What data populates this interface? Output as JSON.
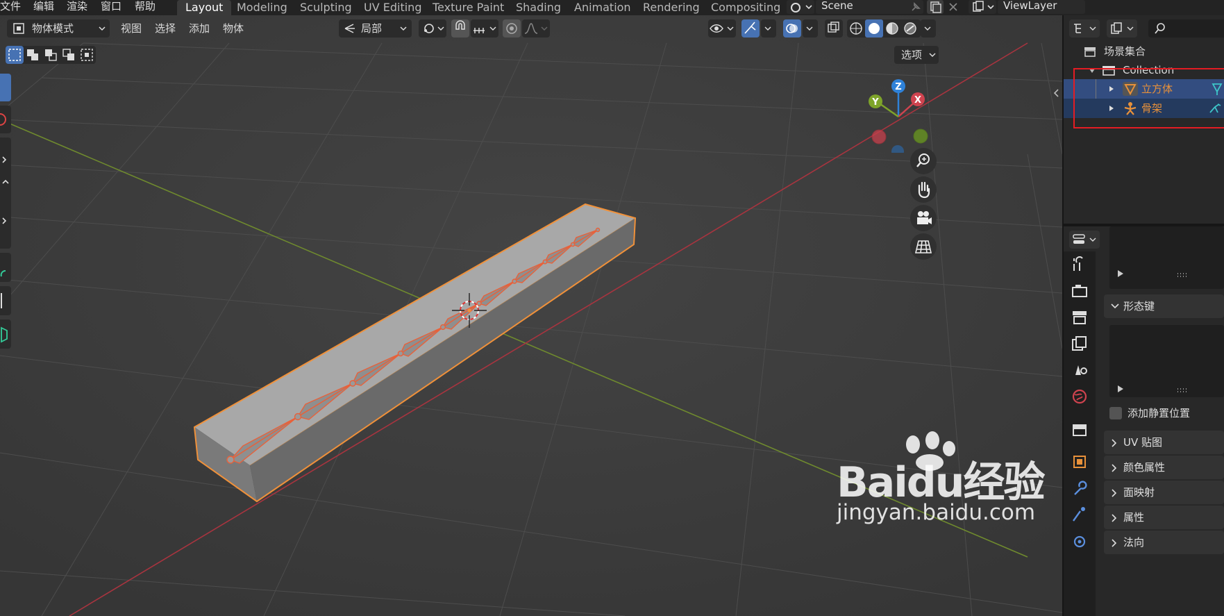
{
  "menu": [
    "文件",
    "编辑",
    "渲染",
    "窗口",
    "帮助"
  ],
  "workspaces": [
    "Layout",
    "Modeling",
    "Sculpting",
    "UV Editing",
    "Texture Paint",
    "Shading",
    "Animation",
    "Rendering",
    "Compositing"
  ],
  "active_workspace": "Layout",
  "scene_name": "Scene",
  "view_layer": "ViewLayer",
  "viewport_header": {
    "mode": "物体模式",
    "menus": [
      "视图",
      "选择",
      "添加",
      "物体"
    ],
    "transform_orientation": "局部",
    "options_label": "选项"
  },
  "gizmo": {
    "x": "X",
    "y": "Y",
    "z": "Z"
  },
  "outliner": {
    "root": "场景集合",
    "collection": "Collection",
    "items": [
      {
        "label": "立方体",
        "color": "#e8913a"
      },
      {
        "label": "骨架",
        "color": "#e8913a"
      }
    ]
  },
  "properties": {
    "shape_keys": "形态键",
    "add_rest_position": "添加静置位置",
    "uv_maps": "UV 贴图",
    "color_attributes": "颜色属性",
    "face_maps": "面映射",
    "attributes": "属性",
    "normals": "法向"
  },
  "watermark": {
    "brand": "Baidu经验",
    "url": "jingyan.baidu.com"
  },
  "colors": {
    "accent": "#4772b3",
    "selection": "#e8913a",
    "x_axis": "#d0434f",
    "y_axis": "#7ea42a",
    "z_axis": "#2f82d9"
  }
}
